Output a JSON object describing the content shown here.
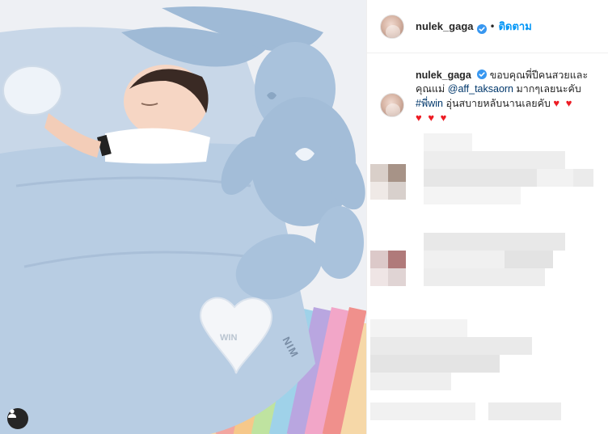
{
  "post": {
    "photo_heart_text": "WIN",
    "photo_blanket_text": "NIM",
    "user_tag_icon": "user-icon"
  },
  "header": {
    "username": "nulek_gaga",
    "separator": "•",
    "follow_label": "ติดตาม",
    "verified_icon": "verified-badge-icon"
  },
  "caption": {
    "username": "nulek_gaga",
    "text_1": "ขอบคุณพี่ปีคนสวยและคุณแม่",
    "mention": "@aff_taksaorn",
    "text_2": "มากๆเลยนะคับ",
    "hashtag": "#พี่win",
    "text_3": "อุ่นสบายหลับนานเลยคับ",
    "hearts_line1": "♥ ♥",
    "hearts_line2": "♥ ♥ ♥"
  },
  "colors": {
    "accent": "#0095f6",
    "link": "#00376b",
    "heart": "#ed1c24",
    "verified": "#3897f0"
  }
}
